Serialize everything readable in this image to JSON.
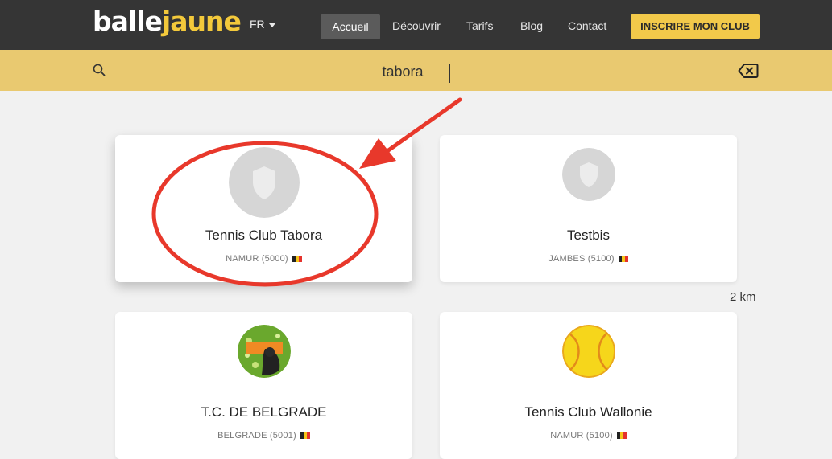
{
  "header": {
    "logo_white": "balle",
    "logo_yellow": "jaune",
    "language": "FR",
    "nav": [
      "Accueil",
      "Découvrir",
      "Tarifs",
      "Blog",
      "Contact"
    ],
    "cta": "INSCRIRE MON CLUB"
  },
  "search": {
    "value": "tabora",
    "search_icon": "search-icon",
    "clear_icon": "backspace-clear-icon"
  },
  "results": [
    {
      "name": "Tennis Club Tabora",
      "location": "NAMUR (5000)",
      "avatar": "shield-placeholder"
    },
    {
      "name": "Testbis",
      "location": "JAMBES (5100)",
      "avatar": "shield-placeholder"
    },
    {
      "name": "T.C. DE BELGRADE",
      "location": "BELGRADE (5001)",
      "avatar": "club-logo-green"
    },
    {
      "name": "Tennis Club Wallonie",
      "location": "NAMUR (5100)",
      "avatar": "tennis-ball-logo"
    }
  ],
  "distance": "2 km",
  "colors": {
    "navbar": "#353535",
    "brand_yellow": "#f2c94a",
    "searchbar": "#e9c970",
    "annotation_red": "#e8382b"
  }
}
